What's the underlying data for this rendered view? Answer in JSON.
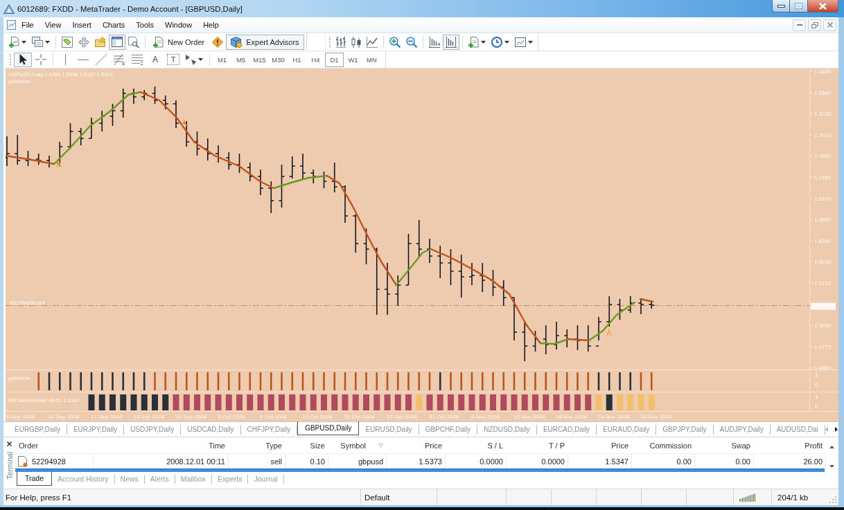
{
  "window": {
    "title": "6012689: FXDD - MetaTrader - Demo Account - [GBPUSD,Daily]"
  },
  "menu": [
    "File",
    "View",
    "Insert",
    "Charts",
    "Tools",
    "Window",
    "Help"
  ],
  "toolbar": {
    "panels": [
      {
        "kind": "tag-page",
        "on": false
      },
      {
        "kind": "four-arrows",
        "on": false
      },
      {
        "kind": "folder-star",
        "on": false
      },
      {
        "kind": "window-panel",
        "on": true
      },
      {
        "kind": "page-magnifier",
        "on": false
      }
    ],
    "new_order": "New Order",
    "expert_advisors": {
      "label": "Expert Advisors",
      "on": true
    },
    "view_toggles": [
      {
        "kind": "shift",
        "on": false
      },
      {
        "kind": "scroll",
        "on": true
      }
    ]
  },
  "drawing_tools": [
    {
      "kind": "cursor",
      "selected": true
    },
    {
      "kind": "crosshair",
      "selected": false
    },
    {
      "kind": "vertical-line",
      "selected": false
    },
    {
      "kind": "horizontal-line",
      "selected": false
    },
    {
      "kind": "trend-line",
      "selected": false
    },
    {
      "kind": "fibonacci",
      "selected": false
    },
    {
      "kind": "channel",
      "selected": false
    },
    {
      "kind": "text",
      "glyph": "A",
      "selected": false
    },
    {
      "kind": "label",
      "glyph": "T",
      "selected": false
    },
    {
      "kind": "arrows",
      "selected": false
    }
  ],
  "timeframes": [
    {
      "label": "M1",
      "selected": false
    },
    {
      "label": "M5",
      "selected": false
    },
    {
      "label": "M15",
      "selected": false
    },
    {
      "label": "M30",
      "selected": false
    },
    {
      "label": "H1",
      "selected": false
    },
    {
      "label": "H4",
      "selected": false
    },
    {
      "label": "D1",
      "selected": true
    },
    {
      "label": "W1",
      "selected": false
    },
    {
      "label": "MN",
      "selected": false
    }
  ],
  "chart": {
    "legend": "GBPUSD,Daily  1.5364 1.5396 1.5337 1.5343",
    "indicator": "goldminer",
    "order_label": "#52294928 sell",
    "price_axis": [
      {
        "kind": "tick",
        "label": "1.8855"
      },
      {
        "kind": "tick",
        "label": "1.8540"
      },
      {
        "kind": "tick",
        "label": "1.8225"
      },
      {
        "kind": "tick",
        "label": "1.7910"
      },
      {
        "kind": "tick",
        "label": "1.7600"
      },
      {
        "kind": "tick",
        "label": "1.7285"
      },
      {
        "kind": "tick",
        "label": "1.6970"
      },
      {
        "kind": "tick",
        "label": "1.6660"
      },
      {
        "kind": "tick",
        "label": "1.6345"
      },
      {
        "kind": "tick",
        "label": "1.6030"
      },
      {
        "kind": "tick",
        "label": "1.5715"
      },
      {
        "kind": "marker"
      },
      {
        "kind": "tick",
        "label": "1.5090"
      },
      {
        "kind": "tick",
        "label": "1.4775"
      },
      {
        "kind": "tick",
        "label": "1.4460"
      }
    ],
    "panes": [
      {
        "label": "goldminer",
        "scale": [
          "1",
          "0"
        ]
      },
      {
        "label": "RSI above/under 49/51 1.0000",
        "scale": [
          "1",
          "0"
        ]
      }
    ],
    "date_axis": [
      "5 Sep 2008",
      "11 Sep 2008",
      "17 Sep 2008",
      "23 Sep 2008",
      "29 Sep 2008",
      "3 Oct 2008",
      "9 Oct 2008",
      "15 Oct 2008",
      "21 Oct 2008",
      "27 Oct 2008",
      "31 Oct 2008",
      "6 Nov 2008",
      "12 Nov 2008",
      "18 Nov 2008",
      "24 Nov 2008",
      "28 Nov 2008"
    ]
  },
  "symbol_tabs": [
    {
      "label": "EURGBP,Daily",
      "selected": false
    },
    {
      "label": "EURJPY,Daily",
      "selected": false
    },
    {
      "label": "USDJPY,Daily",
      "selected": false
    },
    {
      "label": "USDCAD,Daily",
      "selected": false
    },
    {
      "label": "CHFJPY,Daily",
      "selected": false
    },
    {
      "label": "GBPUSD,Daily",
      "selected": true
    },
    {
      "label": "EURUSD,Daily",
      "selected": false
    },
    {
      "label": "GBPCHF,Daily",
      "selected": false
    },
    {
      "label": "NZDUSD,Daily",
      "selected": false
    },
    {
      "label": "EURCAD,Daily",
      "selected": false
    },
    {
      "label": "EURAUD,Daily",
      "selected": false
    },
    {
      "label": "GBPJPY,Daily",
      "selected": false
    },
    {
      "label": "AUDJPY,Daily",
      "selected": false
    },
    {
      "label": "AUDUSD,Dai",
      "selected": false
    }
  ],
  "terminal": {
    "title": "Terminal",
    "columns": [
      "Order",
      "Time",
      "Type",
      "Size",
      "Symbol",
      "Price",
      "S / L",
      "T / P",
      "Price",
      "Commission",
      "Swap",
      "Profit"
    ],
    "rows": [
      {
        "cells": [
          "52294928",
          "2008.12.01 00:11",
          "sell",
          "0.10",
          "gbpusd",
          "1.5373",
          "0.0000",
          "0.0000",
          "1.5347",
          "0.00",
          "0.00",
          "26.00"
        ]
      }
    ],
    "tabs": [
      {
        "label": "Trade",
        "selected": true
      },
      {
        "label": "Account History",
        "selected": false
      },
      {
        "label": "News",
        "selected": false
      },
      {
        "label": "Alerts",
        "selected": false
      },
      {
        "label": "Mailbox",
        "selected": false
      },
      {
        "label": "Experts",
        "selected": false
      },
      {
        "label": "Journal",
        "selected": false
      }
    ]
  },
  "status_bar": {
    "help": "For Help, press F1",
    "profile": "Default",
    "traffic": "204/1 kb"
  }
}
